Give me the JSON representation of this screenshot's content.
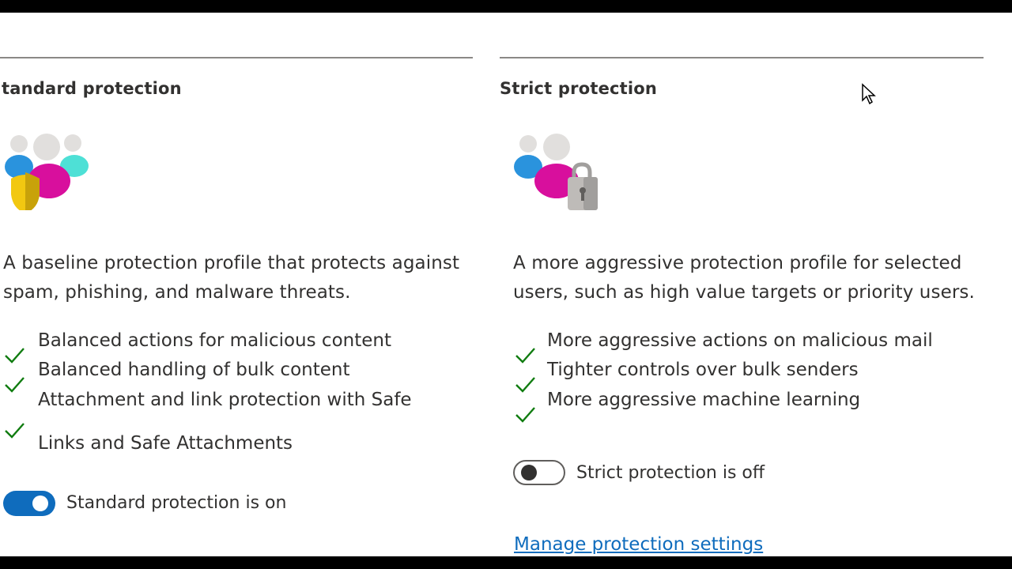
{
  "standard": {
    "title": "tandard protection",
    "icon": "users-shield-icon",
    "description_line1": "A baseline protection profile that protects against",
    "description_line2": "spam, phishing, and malware threats.",
    "features": [
      "Balanced actions for malicious content",
      "Balanced handling of bulk content",
      "Attachment and link protection with Safe",
      "Links and Safe Attachments"
    ],
    "toggle_label": "Standard protection is on",
    "toggle_on": true
  },
  "strict": {
    "title": "Strict protection",
    "icon": "users-lock-icon",
    "description_line1": "A more aggressive protection profile for selected",
    "description_line2": "users, such as high value targets or priority users.",
    "features": [
      "More aggressive actions on malicious mail",
      "Tighter controls over bulk senders",
      "More aggressive machine learning"
    ],
    "toggle_label": "Strict protection is off",
    "toggle_on": false
  },
  "manage_link": "Manage protection settings",
  "colors": {
    "accent": "#0f6cbd",
    "check": "#107c10",
    "rule": "#8a8886",
    "text": "#323130"
  }
}
